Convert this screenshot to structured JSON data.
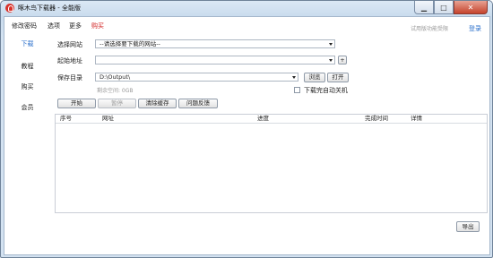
{
  "window": {
    "title": "啄木鸟下载器 - 全能版",
    "controls": {
      "minimize": "▁",
      "maximize": "□",
      "close": "✕"
    }
  },
  "menu": {
    "items": [
      "修改密码",
      "选项",
      "更多",
      "购买"
    ],
    "trial_text": "试用版功能受限",
    "login": "登录"
  },
  "sidebar": {
    "items": [
      "下载",
      "教程",
      "购买",
      "会员"
    ],
    "active": "下载"
  },
  "form": {
    "site_label": "选择网站",
    "site_value": "--请选择要下载的网站--",
    "start_url_label": "起始地址",
    "start_url_value": "",
    "add_label": "+",
    "save_dir_label": "保存目录",
    "save_dir_value": "D:\\Output\\",
    "browse_label": "浏览",
    "open_label": "打开",
    "free_space": "剩余空间: 0GB",
    "auto_shutdown_label": "下载完自动关机",
    "auto_shutdown_checked": false
  },
  "actions": {
    "start": "开始",
    "pause": "暂停",
    "clear_cache": "清除缓存",
    "feedback": "问题反馈"
  },
  "table": {
    "columns": [
      "序号",
      "网址",
      "进度",
      "完成时间",
      "详情"
    ],
    "rows": []
  },
  "export_label": "导出",
  "colors": {
    "accent": "#2a6fcb",
    "buy_red": "#d02020",
    "close_red": "#c5432c"
  }
}
